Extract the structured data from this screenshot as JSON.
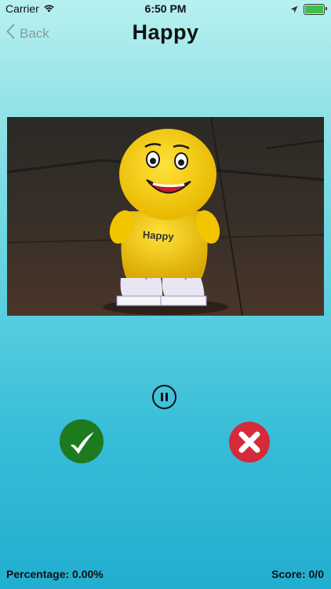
{
  "status_bar": {
    "carrier": "Carrier",
    "time": "6:50 PM",
    "battery_level": 1.0
  },
  "nav": {
    "back_label": "Back",
    "title": "Happy"
  },
  "photo": {
    "icon": "happy-plush-photo",
    "label_on_toy": "Happy"
  },
  "controls": {
    "pause_icon": "pause-icon",
    "correct_icon": "checkmark-icon",
    "wrong_icon": "x-icon",
    "correct_color": "#1e7a1e",
    "wrong_color": "#d42a3a"
  },
  "footer": {
    "percentage": "Percentage: 0.00%",
    "score": "Score: 0/0"
  }
}
